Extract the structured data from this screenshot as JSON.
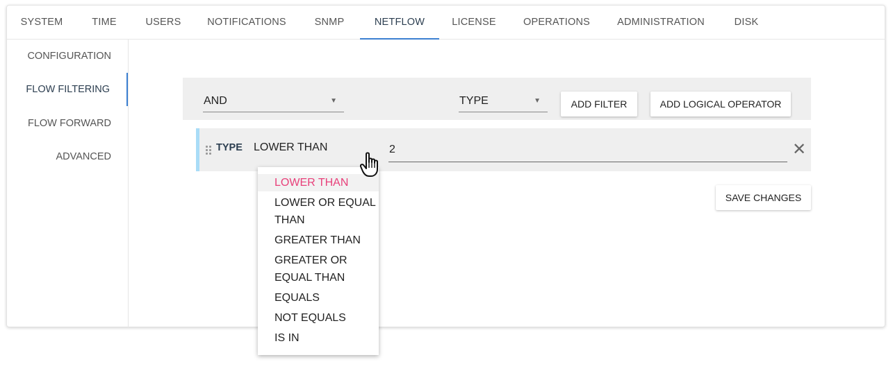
{
  "tabs": [
    {
      "label": "SYSTEM",
      "active": false
    },
    {
      "label": "TIME",
      "active": false
    },
    {
      "label": "USERS",
      "active": false
    },
    {
      "label": "NOTIFICATIONS",
      "active": false
    },
    {
      "label": "SNMP",
      "active": false
    },
    {
      "label": "NETFLOW",
      "active": true
    },
    {
      "label": "LICENSE",
      "active": false
    },
    {
      "label": "OPERATIONS",
      "active": false
    },
    {
      "label": "ADMINISTRATION",
      "active": false
    },
    {
      "label": "DISK",
      "active": false
    }
  ],
  "sidenav": [
    {
      "label": "CONFIGURATION",
      "active": false
    },
    {
      "label": "FLOW FILTERING",
      "active": true
    },
    {
      "label": "FLOW FORWARD",
      "active": false
    },
    {
      "label": "ADVANCED",
      "active": false
    }
  ],
  "builder": {
    "logical_operator": "AND",
    "filter_type": "TYPE",
    "add_filter_label": "ADD FILTER",
    "add_logical_operator_label": "ADD LOGICAL OPERATOR"
  },
  "rule": {
    "field_label": "TYPE",
    "operator": "LOWER THAN",
    "value": "2"
  },
  "operator_options": [
    "LOWER THAN",
    "LOWER OR EQUAL THAN",
    "GREATER THAN",
    "GREATER OR EQUAL THAN",
    "EQUALS",
    "NOT EQUALS",
    "IS IN"
  ],
  "save_label": "SAVE CHANGES",
  "colors": {
    "accent": "#3b7fd1",
    "selected_option": "#e8407a",
    "rule_border": "#a9dcf7"
  }
}
